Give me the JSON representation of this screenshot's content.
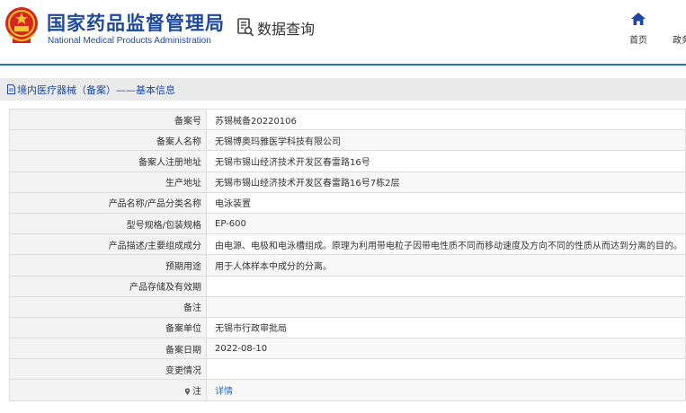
{
  "header": {
    "brand_cn": "国家药品监督管理局",
    "brand_en": "National Medical Products Administration",
    "section_title": "数据查询",
    "nav": {
      "home": "首页",
      "more": "政务"
    }
  },
  "breadcrumb": {
    "text": "境内医疗器械（备案）——基本信息"
  },
  "colors": {
    "brand_blue": "#1d4a9e",
    "accent_line": "#2a6db8",
    "link": "#1d6fd6"
  },
  "details": {
    "rows": [
      {
        "label": "备案号",
        "value": "苏锡械备20220106"
      },
      {
        "label": "备案人名称",
        "value": "无锡博奥玛雅医学科技有限公司"
      },
      {
        "label": "备案人注册地址",
        "value": "无锡市锡山经济技术开发区春雷路16号"
      },
      {
        "label": "生产地址",
        "value": "无锡市锡山经济技术开发区春雷路16号7栋2层"
      },
      {
        "label": "产品名称/产品分类名称",
        "value": "电泳装置"
      },
      {
        "label": "型号规格/包装规格",
        "value": "EP-600"
      },
      {
        "label": "产品描述/主要组成成分",
        "value": "由电源、电极和电泳槽组成。原理为利用带电粒子因带电性质不同而移动速度及方向不同的性质从而达到分离的目的。"
      },
      {
        "label": "预期用途",
        "value": "用于人体样本中成分的分离。"
      },
      {
        "label": "产品存储及有效期",
        "value": ""
      },
      {
        "label": "备注",
        "value": ""
      },
      {
        "label": "备案单位",
        "value": "无锡市行政审批局"
      },
      {
        "label": "备案日期",
        "value": "2022-08-10"
      },
      {
        "label": "变更情况",
        "value": ""
      }
    ],
    "note_label": "注",
    "note_link": "详情"
  }
}
